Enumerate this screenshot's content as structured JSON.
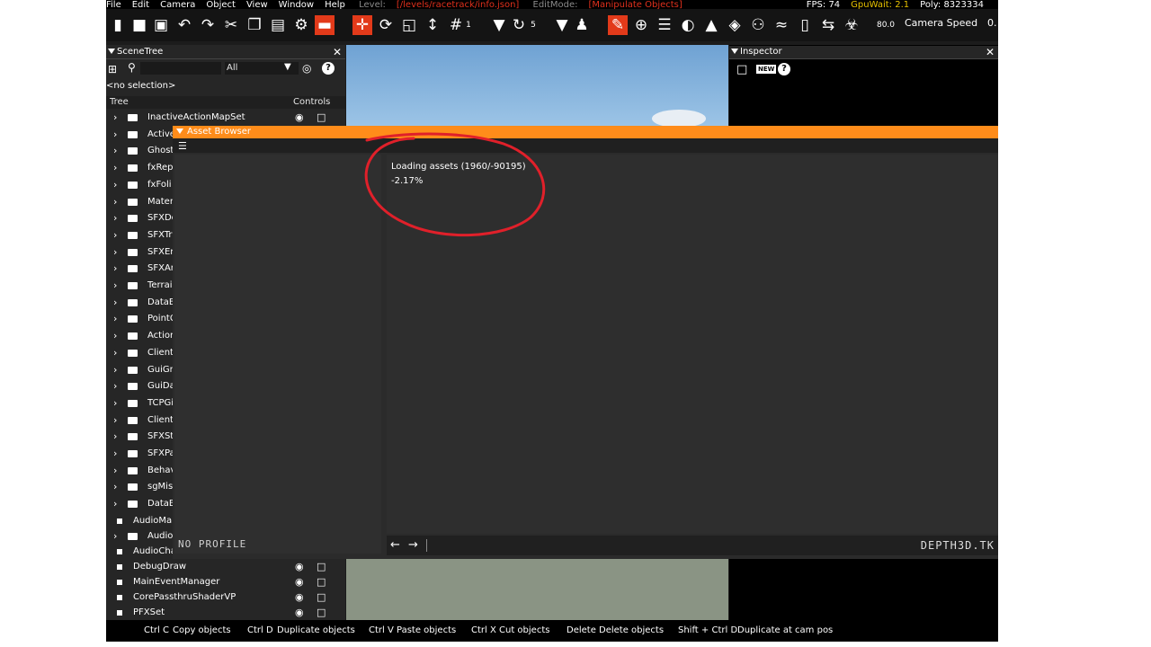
{
  "menu": {
    "items": [
      "File",
      "Edit",
      "Camera",
      "Object",
      "View",
      "Window",
      "Help"
    ],
    "level_label": "Level:",
    "level_value": "[/levels/racetrack/info.json]",
    "editmode_label": "EditMode:",
    "editmode_value": "[Manipulate Objects]",
    "fps": "FPS: 74",
    "gpuwait": "GpuWait: 2.1",
    "poly": "Poly: 8323334"
  },
  "toolbar": {
    "grid_size": "1",
    "rotate_step": "5",
    "speed_value": "80.0",
    "camera_speed_label": "Camera Speed",
    "right_value": "0."
  },
  "scene_tree": {
    "title": "SceneTree",
    "filter_value": "All",
    "selection": "<no selection>",
    "col_tree": "Tree",
    "col_controls": "Controls",
    "folders": [
      "InactiveActionMapSet",
      "Active",
      "Ghost",
      "fxRep",
      "fxFoli",
      "Mater",
      "SFXDe",
      "SFXTr",
      "SFXEn",
      "SFXAr",
      "Terrai",
      "DataB",
      "PointC",
      "Action",
      "Client",
      "GuiGr",
      "GuiDa",
      "TCPGi",
      "Client",
      "SFXSt",
      "SFXPa",
      "Behav",
      "sgMis",
      "DataB"
    ],
    "leaves": [
      "AudioMa",
      "Audio",
      "AudioCha",
      "DebugDraw",
      "MainEventManager",
      "CorePassthruShaderVP",
      "PFXSet"
    ]
  },
  "inspector": {
    "title": "Inspector",
    "new_label": "NEW"
  },
  "asset_browser": {
    "title": "Asset Browser",
    "loading_text": "Loading assets (1960/-90195)",
    "percent": "-2.17%",
    "profile_text": "NO PROFILE",
    "brand": "DEPTH3D.TK"
  },
  "status_bar": [
    {
      "key": "Ctrl C",
      "action": "Copy objects"
    },
    {
      "key": "Ctrl D",
      "action": "Duplicate objects"
    },
    {
      "key": "Ctrl V",
      "action": "Paste objects"
    },
    {
      "key": "Ctrl X",
      "action": "Cut objects"
    },
    {
      "key": "Delete",
      "action": "Delete objects"
    },
    {
      "key": "Shift + Ctrl D",
      "action": "Duplicate at cam pos"
    }
  ],
  "colors": {
    "accent_orange": "#ff8c1a",
    "toolbar_red": "#e23a1a",
    "annotation_red": "#e0202a"
  }
}
